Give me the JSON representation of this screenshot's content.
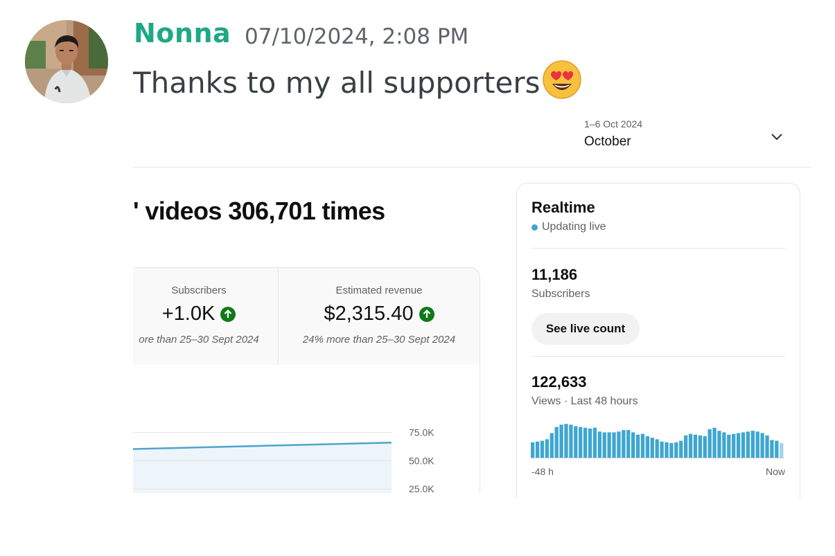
{
  "message": {
    "author": "Nonna",
    "timestamp": "07/10/2024, 2:08 PM",
    "text": "Thanks to my all supporters",
    "emoji": "smiling-face-with-heart-eyes"
  },
  "screenshot": {
    "date_range": {
      "range": "1–6 Oct 2024",
      "period": "October"
    },
    "headline": "' videos 306,701 times",
    "cards": [
      {
        "label": "Subscribers",
        "value": "+1.0K",
        "sub": "ore than 25–30 Sept 2024",
        "trend": "up"
      },
      {
        "label": "Estimated revenue",
        "value": "$2,315.40",
        "sub": "24% more than 25–30 Sept 2024",
        "trend": "up"
      }
    ],
    "chart_data": {
      "type": "area",
      "y_ticks": [
        "75.0K",
        "50.0K",
        "25.0K"
      ],
      "ylim": [
        0,
        90000
      ],
      "series": [
        {
          "values": [
            60000,
            61000,
            62000,
            63000,
            64000,
            65000,
            66000
          ]
        }
      ],
      "colors": {
        "line": "#4fa3cc",
        "fill": "#edf5fb"
      }
    },
    "realtime": {
      "title": "Realtime",
      "status": "Updating live",
      "subscribers_count": "11,186",
      "subscribers_label": "Subscribers",
      "live_button": "See live count",
      "views_count": "122,633",
      "views_label": "Views · Last 48 hours",
      "axis_start": "-48 h",
      "axis_end": "Now",
      "bar_color": "#3ea6d0",
      "bars": [
        20,
        21,
        22,
        24,
        32,
        40,
        43,
        44,
        43,
        41,
        40,
        39,
        38,
        39,
        34,
        33,
        33,
        33,
        34,
        36,
        36,
        33,
        30,
        31,
        28,
        26,
        24,
        21,
        20,
        19,
        20,
        22,
        29,
        31,
        30,
        29,
        28,
        37,
        39,
        35,
        33,
        30,
        31,
        32,
        33,
        34,
        35,
        34,
        32,
        29,
        23,
        22,
        19
      ]
    }
  }
}
